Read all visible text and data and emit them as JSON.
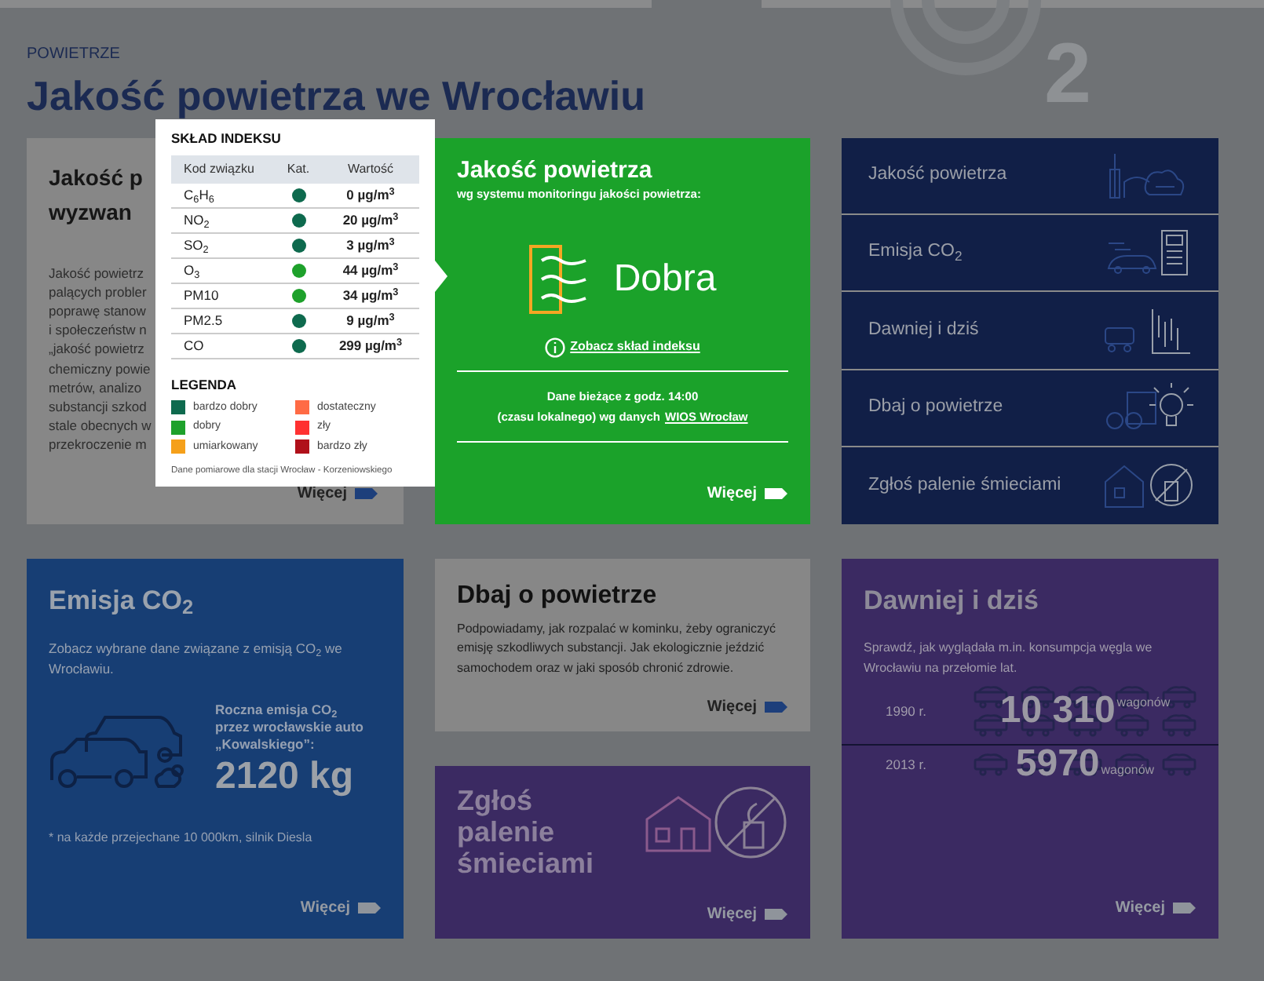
{
  "header": {
    "section_label": "POWIETRZE",
    "title": "Jakość powietrza we Wrocławiu",
    "background_glyph": "2"
  },
  "intro_card": {
    "title_lines": [
      "Jakość p",
      "wyzwan"
    ],
    "body_lines": [
      "Jakość powietrz",
      "palących probler",
      "poprawę stanow",
      "i społeczeństw n",
      "„jakość powietrz",
      "chemiczny powie",
      "metrów, analizo",
      "substancji szkod",
      "stale obecnych w",
      "przekroczenie m"
    ],
    "more": "Więcej"
  },
  "index_popup": {
    "title": "SKŁAD INDEKSU",
    "columns": [
      "Kod związku",
      "Kat.",
      "Wartość"
    ],
    "rows": [
      {
        "code": "C$_{6}$H$_{6}$",
        "color": "#0e6a4e",
        "value": "0 µg/m$^{3}$"
      },
      {
        "code": "NO$_{2}$",
        "color": "#0e6a4e",
        "value": "20 µg/m$^{3}$"
      },
      {
        "code": "SO$_{2}$",
        "color": "#0e6a4e",
        "value": "3 µg/m$^{3}$"
      },
      {
        "code": "O$_{3}$",
        "color": "#1ea12b",
        "value": "44 µg/m$^{3}$"
      },
      {
        "code": "PM10",
        "color": "#1ea12b",
        "value": "34 µg/m$^{3}$"
      },
      {
        "code": "PM2.5",
        "color": "#0e6a4e",
        "value": "9 µg/m$^{3}$"
      },
      {
        "code": "CO",
        "color": "#0e6a4e",
        "value": "299 µg/m$^{3}$"
      }
    ],
    "legend_title": "LEGENDA",
    "legend": [
      {
        "label": "bardzo dobry",
        "color": "#0e6a4e"
      },
      {
        "label": "dobry",
        "color": "#1ea12b"
      },
      {
        "label": "umiarkowany",
        "color": "#f5a01a"
      },
      {
        "label": "dostateczny",
        "color": "#ff6b45"
      },
      {
        "label": "zły",
        "color": "#ff3131"
      },
      {
        "label": "bardzo zły",
        "color": "#b0101a"
      }
    ],
    "footnote": "Dane pomiarowe dla stacji Wrocław - Korzeniowskiego"
  },
  "air_card": {
    "title": "Jakość powietrza",
    "subtitle": "wg systemu monitoringu jakości powietrza:",
    "status": "Dobra",
    "index_link": "Zobacz skład indeksu",
    "update_line1": "Dane bieżące z godz. 14:00",
    "update_line2": "(czasu lokalnego) wg danych",
    "source_link": "WIOS Wrocław",
    "more": "Więcej"
  },
  "nav": [
    {
      "label": "Jakość powietrza"
    },
    {
      "label": "Emisja CO$_{2}$"
    },
    {
      "label": "Dawniej i dziś"
    },
    {
      "label": "Dbaj o powietrze"
    },
    {
      "label": "Zgłoś palenie śmieciami"
    }
  ],
  "emission_card": {
    "title": "Emisja CO$_{2}$",
    "intro": "Zobacz wybrane dane związane z emisją CO$_{2}$ we Wrocławiu.",
    "stat_label": "Roczna emisja CO$_{2}$ przez wrocławskie auto „Kowalskiego”:",
    "stat_value": "2120 kg",
    "footnote": "* na każde przejechane 10 000km, silnik Diesla",
    "more": "Więcej"
  },
  "care_card": {
    "title": "Dbaj o powietrze",
    "text": "Podpowiadamy, jak rozpalać w kominku, żeby ograniczyć emisję szkodliwych substancji. Jak ekologicznie jeździć samochodem oraz w jaki sposób chronić zdrowie.",
    "more": "Więcej"
  },
  "report_card": {
    "title": "Zgłoś palenie śmieciami",
    "more": "Więcej"
  },
  "history_card": {
    "title": "Dawniej i dziś",
    "text": "Sprawdź, jak wyglądała m.in. konsumpcja węgla we Wrocławiu na przełomie lat.",
    "periods": [
      {
        "year": "1990 r.",
        "value": "10 310",
        "unit": "wagonów"
      },
      {
        "year": "2013 r.",
        "value": "5970",
        "unit": "wagonów"
      }
    ],
    "more": "Więcej"
  }
}
